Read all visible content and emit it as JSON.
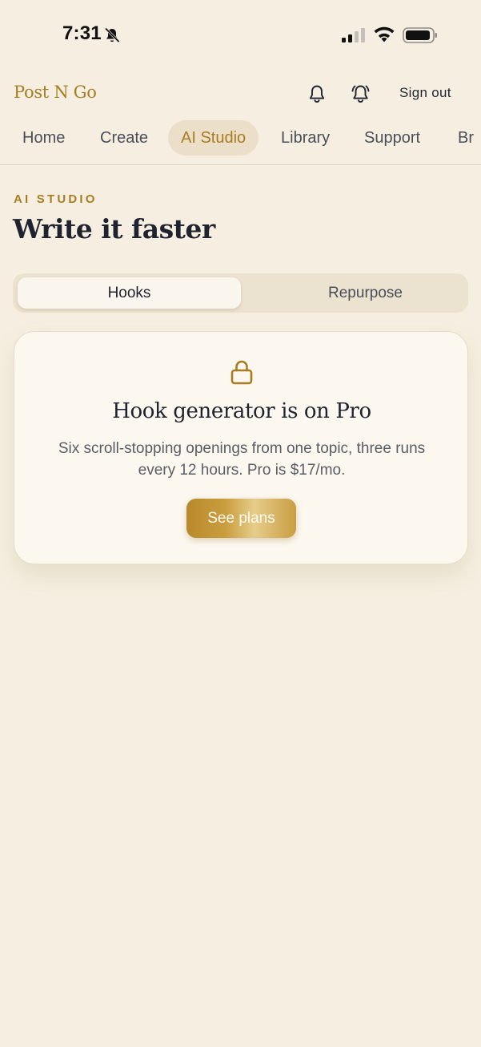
{
  "status_bar": {
    "time": "7:31",
    "silent_icon": "bell-slash-icon",
    "signal_icon": "cellular-signal-icon",
    "wifi_icon": "wifi-icon",
    "battery_icon": "battery-icon"
  },
  "header": {
    "brand": "Post N Go",
    "notifications_icon": "bell-icon",
    "alerts_icon": "bell-ringing-icon",
    "sign_out": "Sign out"
  },
  "nav": {
    "items": [
      {
        "label": "Home",
        "active": false
      },
      {
        "label": "Create",
        "active": false
      },
      {
        "label": "AI Studio",
        "active": true
      },
      {
        "label": "Library",
        "active": false
      },
      {
        "label": "Support",
        "active": false
      },
      {
        "label": "Br",
        "active": false
      }
    ]
  },
  "page": {
    "eyebrow": "AI STUDIO",
    "title": "Write it faster"
  },
  "tabs": {
    "items": [
      {
        "label": "Hooks",
        "active": true
      },
      {
        "label": "Repurpose",
        "active": false
      }
    ]
  },
  "locked_card": {
    "icon": "lock-icon",
    "title": "Hook generator is on Pro",
    "description": "Six scroll-stopping openings from one topic, three runs every 12 hours. Pro is $17/mo.",
    "button": "See plans"
  },
  "colors": {
    "background": "#f6efe1",
    "accent": "#a87d22",
    "card": "#fcf8f0"
  }
}
